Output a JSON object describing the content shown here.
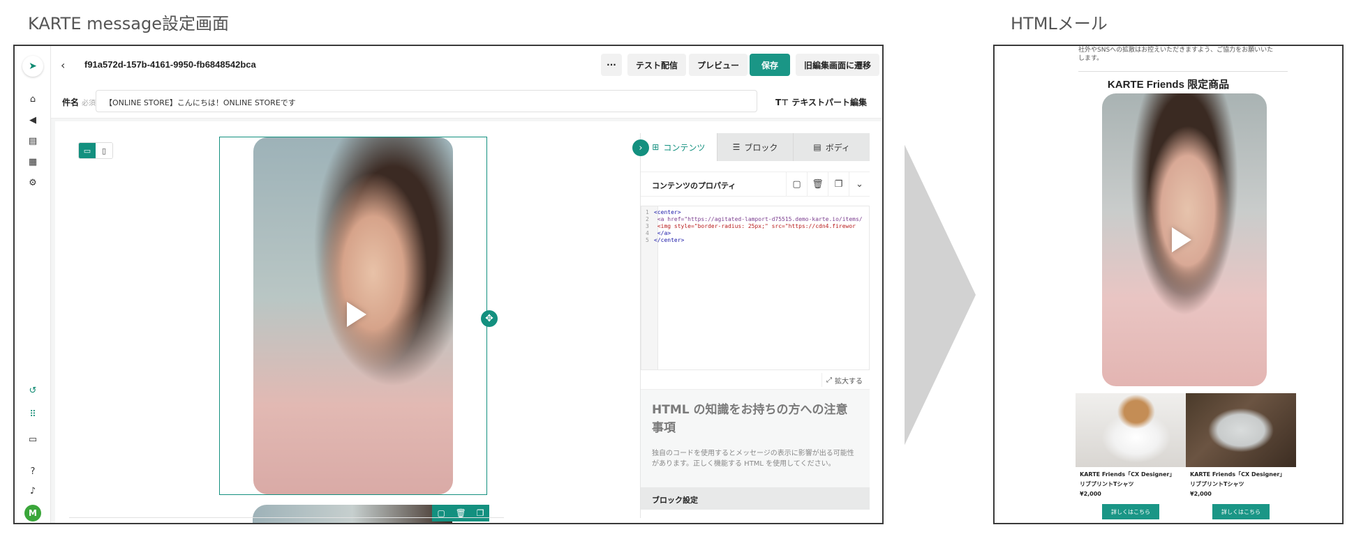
{
  "captions": {
    "left": "KARTE message設定画面",
    "right": "HTMLメール"
  },
  "editor": {
    "campaign_id": "f91a572d-157b-4161-9950-fb6848542bca",
    "toolbar": {
      "more_label": "···",
      "test_send_label": "テスト配信",
      "preview_label": "プレビュー",
      "save_label": "保存",
      "legacy_editor_label": "旧編集画面に遷移"
    },
    "subject": {
      "label": "件名",
      "required": "必須",
      "value": "【ONLINE STORE】こんにちは！ONLINE STOREです"
    },
    "text_part_label": "テキストパート編集",
    "rail_avatar": "M",
    "panel": {
      "tabs": [
        "コンテンツ",
        "ブロック",
        "ボディ"
      ],
      "props_title": "コンテンツのプロパティ",
      "code_lines": [
        {
          "n": "1",
          "text": "<center>"
        },
        {
          "n": "2",
          "text": "  <a href=\"https://agitated-lamport-d75515.demo-karte.io/items/"
        },
        {
          "n": "3",
          "text": "    <img style=\"border-radius: 25px;\" src=\"https://cdn4.firewor"
        },
        {
          "n": "4",
          "text": "  </a>"
        },
        {
          "n": "5",
          "text": "</center>"
        }
      ],
      "expand_label": "拡大する",
      "notice_title": "HTML の知識をお持ちの方への注意事項",
      "notice_body": "独自のコードを使用するとメッセージの表示に影響が出る可能性があります。正しく機能する HTML を使用してください。",
      "block_setting_label": "ブロック設定"
    }
  },
  "email": {
    "top_text": "社外やSNSへの拡散はお控えいただきますよう、ご協力をお願いいたします。",
    "title": "KARTE Friends 限定商品",
    "products": [
      {
        "name_line1": "KARTE Friends「CX Designer」",
        "name_line2": "リブプリントTシャツ",
        "price": "¥2,000",
        "button": "詳しくはこちら"
      },
      {
        "name_line1": "KARTE Friends「CX Designer」",
        "name_line2": "リブプリントTシャツ",
        "price": "¥2,000",
        "button": "詳しくはこちら"
      }
    ]
  },
  "colors": {
    "accent": "#13907f",
    "button": "#1a9686",
    "avatar": "#3aa63a"
  },
  "icons": [
    "send-icon",
    "home-icon",
    "megaphone-icon",
    "segments-icon",
    "calendar-icon",
    "settings-icon",
    "history-icon",
    "apps-icon",
    "window-icon",
    "help-icon",
    "notification-icon",
    "play-icon",
    "move-icon",
    "comment-icon",
    "trash-icon",
    "copy-icon",
    "chevron-down-icon",
    "expand-icon",
    "grid-icon",
    "rows-icon",
    "layout-icon"
  ]
}
